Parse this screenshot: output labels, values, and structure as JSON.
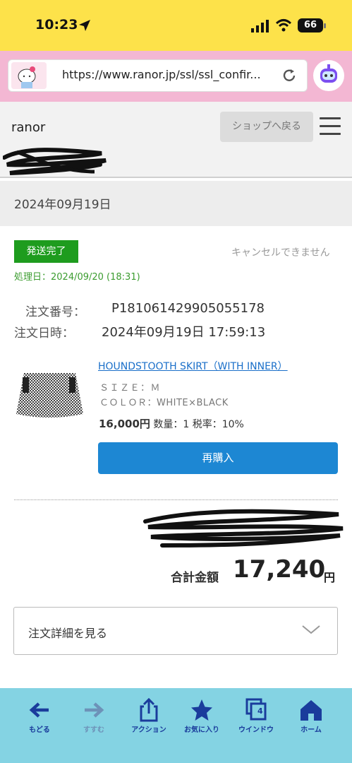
{
  "status": {
    "time": "10:23",
    "battery": "66"
  },
  "browser": {
    "url": "https://www.ranor.jp/ssl/ssl_confir..."
  },
  "header": {
    "brand": "ranor",
    "shop_button": "ショップへ戻る"
  },
  "order": {
    "date_heading": "2024年09月19日",
    "status_badge": "発送完了",
    "cancel_note": "キャンセルできません",
    "processed": "処理日：2024/09/20 (18:31)",
    "number_label": "注文番号：",
    "number_value": "P181061429905055178",
    "datetime_label": "注文日時：",
    "datetime_value": "2024年09月19日 17:59:13"
  },
  "item": {
    "name": "HOUNDSTOOTH SKIRT（WITH INNER）",
    "size": "ＳＩＺＥ：Ｍ",
    "color": "ＣＯＬＯＲ：WHITE×BLACK",
    "price": "16,000円",
    "detail": "数量：1 税率：10%",
    "rebuy_button": "再購入"
  },
  "total": {
    "label": "合計金額",
    "value": "17,240",
    "unit": "円"
  },
  "details_toggle": "注文詳細を見る",
  "toolbar": {
    "back": "もどる",
    "forward": "すすむ",
    "action": "アクション",
    "favorites": "お気に入り",
    "window": "ウインドウ",
    "window_count": "4",
    "home": "ホーム"
  },
  "colors": {
    "status_bar": "#fde24a",
    "browser_bar": "#f3b7d3",
    "badge_green": "#1e9c1e",
    "link_blue": "#1a6fc9",
    "rebuy_blue": "#1d87d3",
    "toolbar": "#84d3e3",
    "toolbar_icon": "#1a3c9c"
  }
}
